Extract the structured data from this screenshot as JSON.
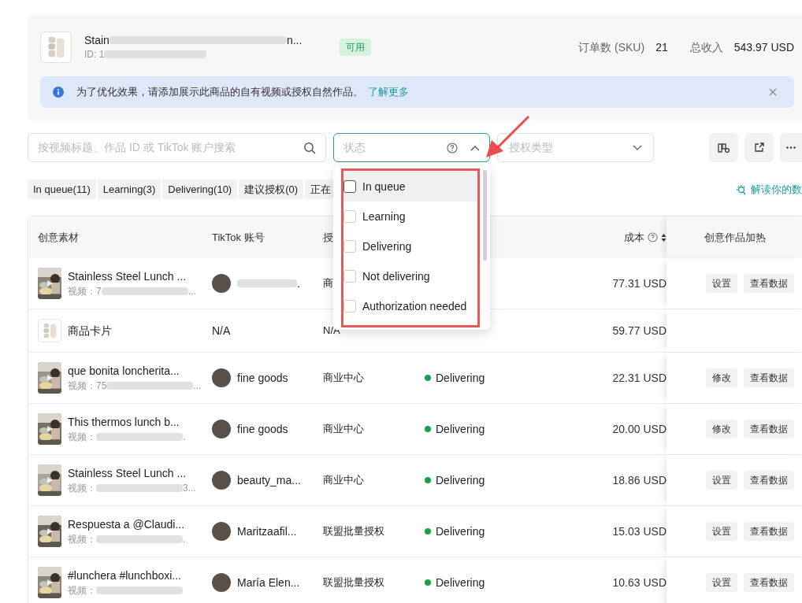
{
  "product": {
    "title": "Stain",
    "title_end": "n...",
    "id_label": "ID: 1",
    "status": "可用"
  },
  "stats": [
    {
      "label": "订单数 (SKU)",
      "value": "21"
    },
    {
      "label": "总收入",
      "value": "543.97 USD"
    }
  ],
  "banner": {
    "text": "为了优化效果，请添加展示此商品的自有视频或授权自然作品。",
    "link": "了解更多"
  },
  "search": {
    "placeholder": "按视频标题、作品 ID 或 TikTok 账户搜索"
  },
  "status_select": {
    "placeholder": "状态",
    "expanded": true
  },
  "auth_select": {
    "placeholder": "授权类型"
  },
  "chips": [
    "In queue(11)",
    "Learning(3)",
    "Delivering(10)",
    "建议授权(0)",
    "正在"
  ],
  "insight_link": "解读你的数",
  "columns": [
    {
      "label": "创意素材"
    },
    {
      "label": "TikTok 账号"
    },
    {
      "label": "授"
    },
    {
      "label": "成本",
      "sortable": true
    },
    {
      "label": "创意作品加热"
    }
  ],
  "rows": [
    {
      "kind": "video",
      "title": "Stainless Steel Lunch ...",
      "subtitle": "视频：7",
      "subtitle_end": "...",
      "account_end": ".",
      "avatar": true,
      "auth": "商",
      "cost": "77.31 USD",
      "actions": [
        "设置",
        "查看数据"
      ]
    },
    {
      "kind": "product",
      "title": "商品卡片",
      "account": "N/A",
      "avatar": false,
      "auth": "N/A",
      "cost": "59.77 USD",
      "actions": []
    },
    {
      "kind": "video",
      "title": "que bonita loncherita...",
      "subtitle": "视频：75",
      "subtitle_end": "...",
      "account": "fine goods",
      "avatar": true,
      "auth": "商业中心",
      "status": "Delivering",
      "cost": "22.31 USD",
      "actions": [
        "修改",
        "查看数据"
      ]
    },
    {
      "kind": "video",
      "title": "This thermos lunch b...",
      "subtitle": "视频：",
      "subtitle_end": ".",
      "account": "fine goods",
      "avatar": true,
      "auth": "商业中心",
      "status": "Delivering",
      "cost": "20.00 USD",
      "actions": [
        "修改",
        "查看数据"
      ]
    },
    {
      "kind": "video",
      "title": "Stainless Steel Lunch ...",
      "subtitle": "视频：",
      "subtitle_end": "3...",
      "account": "beauty_ma...",
      "avatar": true,
      "auth": "商业中心",
      "status": "Delivering",
      "cost": "18.86 USD",
      "actions": [
        "设置",
        "查看数据"
      ]
    },
    {
      "kind": "video",
      "title": "Respuesta a @Claudi...",
      "subtitle": "视频：",
      "subtitle_end": ".",
      "account": "Maritzaafil...",
      "avatar": true,
      "auth": "联盟批量授权",
      "status": "Delivering",
      "cost": "15.03 USD",
      "actions": [
        "设置",
        "查看数据"
      ]
    },
    {
      "kind": "video",
      "title": "#lunchera #lunchboxi...",
      "subtitle": "视频：",
      "account": "María Elen...",
      "avatar": true,
      "auth": "联盟批量授权",
      "status": "Delivering",
      "cost": "10.63 USD",
      "actions": [
        "设置",
        "查看数据"
      ]
    }
  ],
  "dropdown": [
    {
      "label": "In queue",
      "checked": false,
      "selected": true
    },
    {
      "label": "Learning",
      "checked": false,
      "selected": false
    },
    {
      "label": "Delivering",
      "checked": false,
      "selected": false
    },
    {
      "label": "Not delivering",
      "checked": false,
      "selected": false
    },
    {
      "label": "Authorization needed",
      "checked": false,
      "selected": false
    }
  ]
}
